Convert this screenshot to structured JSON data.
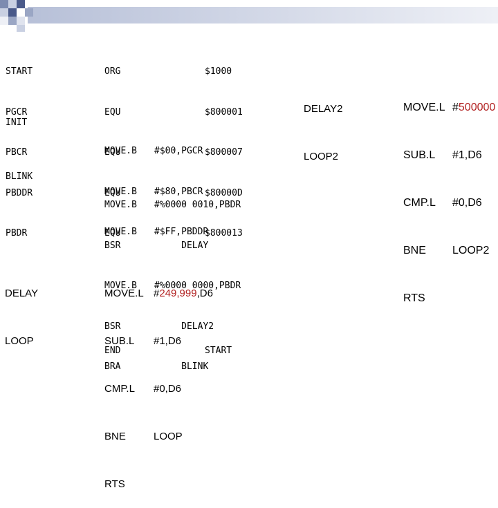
{
  "equates": {
    "labels": [
      "START",
      "PGCR",
      "PBCR",
      "PBDDR",
      "PBDR"
    ],
    "ops": [
      "ORG",
      "EQU",
      "EQU",
      "EQU",
      "EQU"
    ],
    "values": [
      "$1000",
      "$800001",
      "$800007",
      "$80000D",
      "$800013"
    ]
  },
  "init": {
    "label": "INIT",
    "ops": [
      "MOVE.B",
      "MOVE.B",
      "MOVE.B"
    ],
    "operands": [
      "#$00,PGCR",
      "#$80,PBCR",
      "#$FF,PBDDR"
    ]
  },
  "blink": {
    "label": "BLINK",
    "lines": [
      {
        "op": "MOVE.B",
        "operand": "#%0000 0010,PBDR"
      },
      {
        "op": "BSR",
        "operand": "     DELAY"
      },
      {
        "op": "MOVE.B",
        "operand": "#%0000 0000,PBDR"
      },
      {
        "op": "BSR",
        "operand": "     DELAY2"
      },
      {
        "op": "BRA",
        "operand": "     BLINK"
      }
    ]
  },
  "delay": {
    "labels": [
      "DELAY",
      "LOOP"
    ],
    "ops": [
      "MOVE.L",
      "SUB.L",
      "CMP.L",
      "BNE",
      "RTS"
    ],
    "operand0": {
      "prefix": "#",
      "highlight": "249,999",
      "suffix": ",D6"
    },
    "operands": [
      "#1,D6",
      "#0,D6",
      "LOOP"
    ]
  },
  "end": {
    "op": "END",
    "operand": "START"
  },
  "delay2": {
    "labels": [
      "DELAY2",
      "LOOP2"
    ],
    "ops": [
      "MOVE.L",
      "SUB.L",
      "CMP.L",
      "BNE",
      "RTS"
    ],
    "operand0": {
      "prefix": "#",
      "highlight": "500000"
    },
    "operands": [
      "#1,D6",
      "#0,D6",
      "LOOP2"
    ]
  },
  "colors": {
    "highlight": "#b22222",
    "checker_dark": "#4a5a8a",
    "checker_mid": "#9aa6c4",
    "band": "#dfe3ee"
  }
}
